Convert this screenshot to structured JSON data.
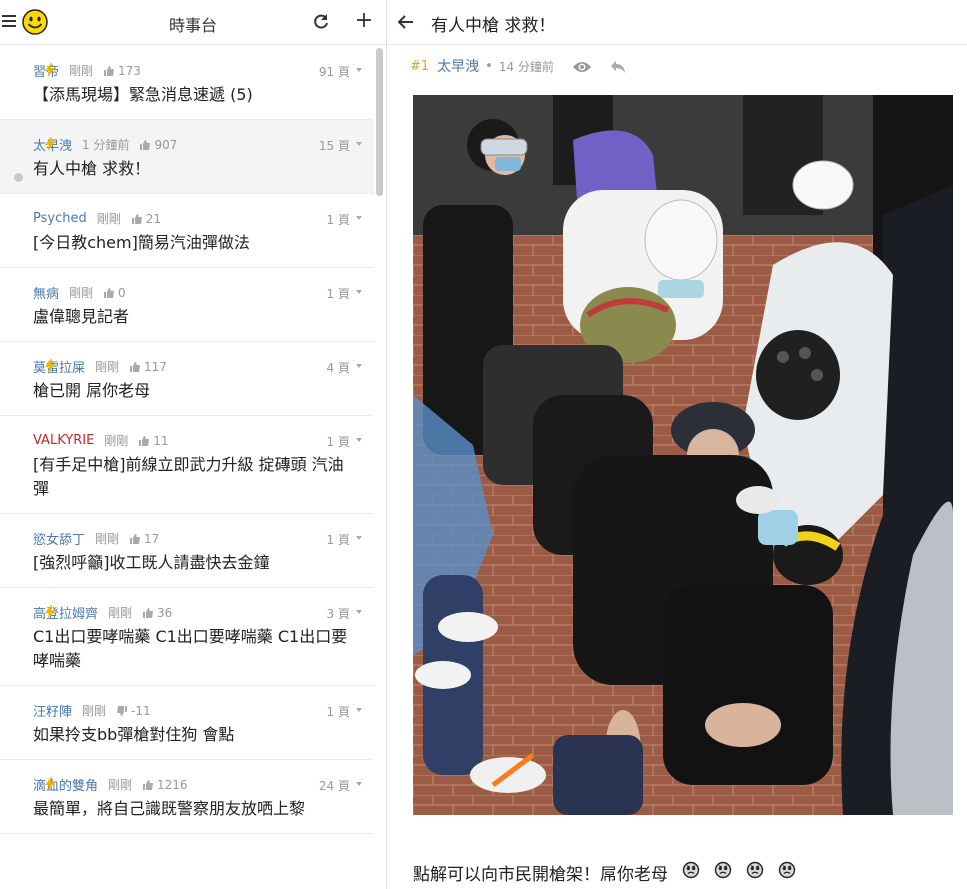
{
  "board": {
    "title": "時事台"
  },
  "threads": [
    {
      "user": "習帝",
      "user_color": "blue",
      "time": "剛剛",
      "likes": "173",
      "pages": "91 頁",
      "title": "【添馬現場】緊急消息速遞 (5)",
      "hot": true,
      "active": false,
      "dislike": false
    },
    {
      "user": "太早洩",
      "user_color": "blue",
      "time": "1 分鐘前",
      "likes": "907",
      "pages": "15 頁",
      "title": "有人中槍 求救！",
      "hot": true,
      "active": true,
      "dislike": false
    },
    {
      "user": "Psyched",
      "user_color": "blue",
      "time": "剛剛",
      "likes": "21",
      "pages": "1 頁",
      "title": "[今日教chem]簡易汽油彈做法",
      "hot": false,
      "active": false,
      "dislike": false
    },
    {
      "user": "無病",
      "user_color": "blue",
      "time": "剛剛",
      "likes": "0",
      "pages": "1 頁",
      "title": "盧偉聰見記者",
      "hot": false,
      "active": false,
      "dislike": false
    },
    {
      "user": "莫雷拉屎",
      "user_color": "blue",
      "time": "剛剛",
      "likes": "117",
      "pages": "4 頁",
      "title": "槍已開 屌你老母",
      "hot": true,
      "active": false,
      "dislike": false
    },
    {
      "user": "VALKYRIE",
      "user_color": "red",
      "time": "剛剛",
      "likes": "11",
      "pages": "1 頁",
      "title": "[有手足中槍]前線立即武力升級 掟磚頭 汽油彈",
      "hot": false,
      "active": false,
      "dislike": false
    },
    {
      "user": "慾女舔丁",
      "user_color": "blue",
      "time": "剛剛",
      "likes": "17",
      "pages": "1 頁",
      "title": "[強烈呼籲]收工既人請盡快去金鐘",
      "hot": false,
      "active": false,
      "dislike": false
    },
    {
      "user": "高登拉姆齊",
      "user_color": "blue",
      "time": "剛剛",
      "likes": "36",
      "pages": "3 頁",
      "title": "C1出口要哮喘藥 C1出口要哮喘藥 C1出口要哮喘藥",
      "hot": true,
      "active": false,
      "dislike": false
    },
    {
      "user": "汪籽陣",
      "user_color": "blue",
      "time": "剛剛",
      "likes": "-11",
      "pages": "1 頁",
      "title": "如果拎支bb彈槍對住狗 會點",
      "hot": false,
      "active": false,
      "dislike": true
    },
    {
      "user": "滴血的雙角",
      "user_color": "blue",
      "time": "剛剛",
      "likes": "1216",
      "pages": "24 頁",
      "title": "最簡單，將自己識既警察朋友放哂上黎",
      "hot": true,
      "active": false,
      "dislike": false
    }
  ],
  "thread_view": {
    "heading": "有人中槍 求救！",
    "post": {
      "number": "#1",
      "user": "太早洩",
      "separator": "•",
      "time": "14 分鐘前",
      "body": "點解可以向市民開槍架！屌你老母",
      "emoji_count": 4
    }
  },
  "colors": {
    "accent_blue": "#4a78b0",
    "accent_red": "#c0282d",
    "accent_gold": "#e3a321",
    "bolt": "#f2b600"
  }
}
